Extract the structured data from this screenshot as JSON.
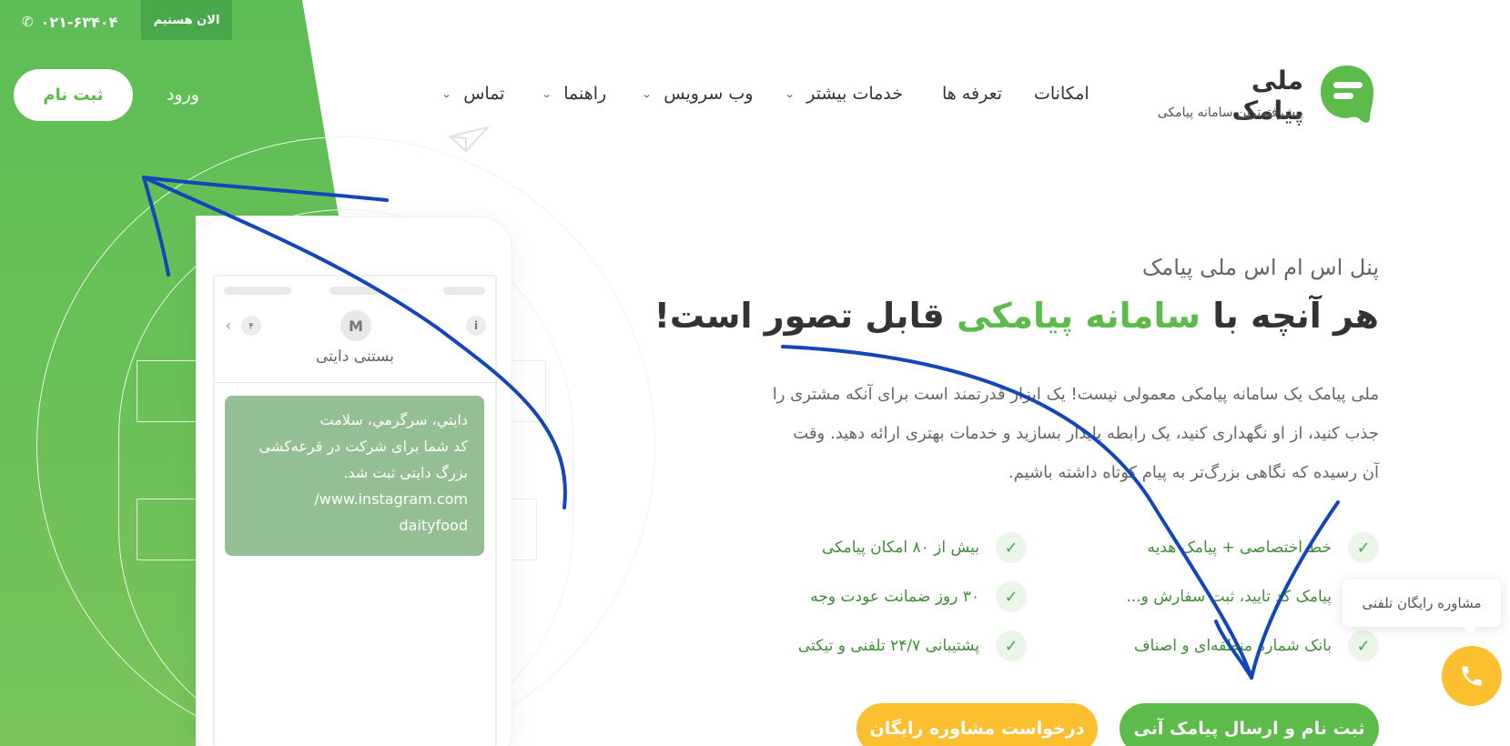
{
  "topbar": {
    "phone": "۰۲۱-۶۳۴۰۴",
    "phone_icon": "phone-icon",
    "online_badge": "الان هستیم"
  },
  "auth": {
    "signup": "ثبت نام",
    "login": "ورود"
  },
  "nav": {
    "items": [
      {
        "label": "امکانات"
      },
      {
        "label": "تعرفه ها"
      },
      {
        "label": "خدمات بیشتر",
        "has_dropdown": true
      },
      {
        "label": "وب سرویس",
        "has_dropdown": true
      },
      {
        "label": "راهنما",
        "has_dropdown": true
      },
      {
        "label": "تماس",
        "has_dropdown": true
      }
    ]
  },
  "logo": {
    "title": "ملی پیامک",
    "subtitle": "پیشرفته‌ترین سامانه پیامکی"
  },
  "phone_mock": {
    "avatar_letter": "M",
    "info": "i",
    "count": "۴",
    "contact": "بستنی دایتی",
    "sms_lines": [
      "دايتي، سرگرمي، سلامت",
      "کد شما برای شرکت در قرعه‌کشی",
      "بزرگ دایتی ثبت شد.",
      "www.instagram.com/",
      "daityfood"
    ]
  },
  "hero": {
    "eyebrow": "پنل اس ام اس ملی پیامک",
    "headline_before": "هر آنچه با ",
    "headline_accent": "سامانه پیامکی",
    "headline_after": " قابل تصور است!",
    "paragraph_lines": [
      "ملی پیامک یک سامانه پیامکی معمولی نیست! یک ابزار قدرتمند است برای آنکه مشتری را",
      "جذب کنید، از او نگهداری کنید، یک رابطه پایدار بسازید و خدمات بهتری ارائه دهید. وقت",
      "آن رسیده که نگاهی بزرگ‌تر به پیام کوتاه داشته باشیم."
    ]
  },
  "features": {
    "right": [
      "خط اختصاصی + پیامک هدیه",
      "پیامک کد تایید، ثبت سفارش و...",
      "بانک شماره منطقه‌ای و اصناف"
    ],
    "left": [
      "بیش از ۸۰ امکان پیامکی",
      "۳۰ روز ضمانت عودت وجه",
      "پشتیبانی ۲۴/۷ تلفنی و تیکتی"
    ]
  },
  "cta": {
    "primary": "ثبت نام و ارسال پیامک آنی",
    "secondary": "درخواست مشاوره رایگان"
  },
  "support": {
    "bubble": "مشاوره رایگان تلفنی",
    "fab_icon": "phone-icon"
  },
  "colors": {
    "brand_green": "#5cbb4a",
    "accent_yellow": "#fbbf2f",
    "annotation_blue": "#1346b8"
  }
}
